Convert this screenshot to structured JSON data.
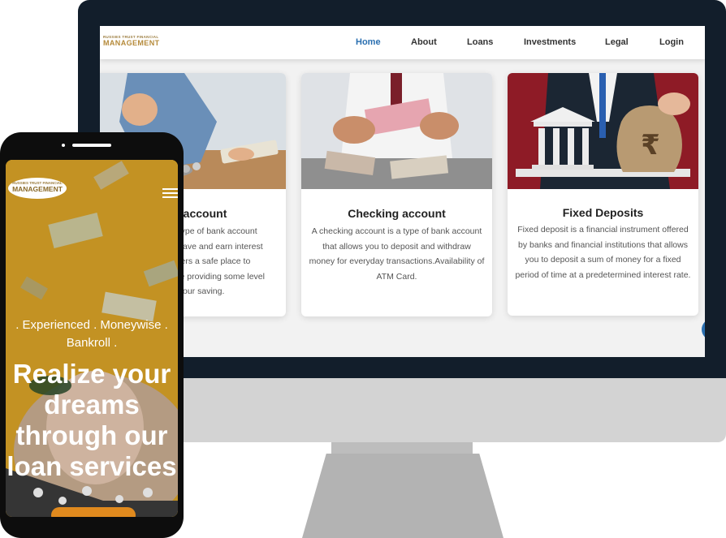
{
  "desktop": {
    "brand": {
      "line1": "RUSSIES TRUST FINANCIAL",
      "line2": "MANAGEMENT"
    },
    "nav": [
      {
        "label": "Home",
        "active": true
      },
      {
        "label": "About"
      },
      {
        "label": "Loans"
      },
      {
        "label": "Investments"
      },
      {
        "label": "Legal"
      },
      {
        "label": "Login"
      }
    ],
    "cards": [
      {
        "title": "s account",
        "lines": [
          "a type of bank account",
          "u save and earn interest",
          "offers a safe place to",
          "hile providing some level",
          "n your saving."
        ]
      },
      {
        "title": "Checking account",
        "lines": [
          "A checking account is a type of bank account",
          "that allows you to deposit and withdraw",
          "money for everyday transactions.Availability of",
          "ATM Card."
        ]
      },
      {
        "title": "Fixed Deposits",
        "lines": [
          "Fixed deposit is a financial instrument offered",
          "by banks and financial institutions that allows",
          "you to deposit a sum of money for a fixed",
          "period of time at a predetermined interest rate."
        ]
      }
    ]
  },
  "mobile": {
    "brand": {
      "line1": "RUSSIES TRUST FINANCIAL",
      "line2": "MANAGEMENT"
    },
    "tagline_line1": ". Experienced . Moneywise .",
    "tagline_line2": "Bankroll .",
    "headline_lines": [
      "Realize your",
      "dreams",
      "through our",
      "loan services"
    ]
  },
  "colors": {
    "nav_active": "#2a6fb0",
    "bezel": "#121e2b",
    "hero_bg": "#d9a52a",
    "brand_gold": "#b58a3a"
  }
}
